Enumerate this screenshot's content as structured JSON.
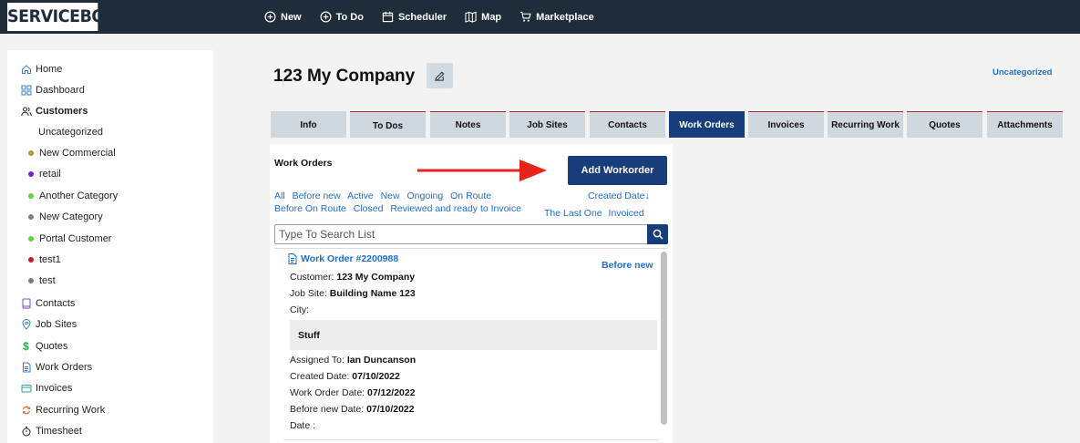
{
  "brand": {
    "logo_text": "SERVICEBOX"
  },
  "topnav": [
    {
      "label": "New",
      "icon": "plus-circle-icon"
    },
    {
      "label": "To Do",
      "icon": "plus-circle-icon"
    },
    {
      "label": "Scheduler",
      "icon": "calendar-icon"
    },
    {
      "label": "Map",
      "icon": "map-icon"
    },
    {
      "label": "Marketplace",
      "icon": "cart-icon"
    }
  ],
  "sidebar": {
    "items": [
      {
        "label": "Home",
        "icon": "home-icon"
      },
      {
        "label": "Dashboard",
        "icon": "dashboard-icon"
      },
      {
        "label": "Customers",
        "icon": "users-icon"
      }
    ],
    "customer_categories": [
      {
        "label": "Uncategorized",
        "color": ""
      },
      {
        "label": "New Commercial",
        "color": "#a69a3c"
      },
      {
        "label": "retail",
        "color": "#7a1fc8"
      },
      {
        "label": "Another Category",
        "color": "#5fd13e"
      },
      {
        "label": "New Category",
        "color": "#7f7f7f"
      },
      {
        "label": "Portal Customer",
        "color": "#5fd13e"
      },
      {
        "label": "test1",
        "color": "#c8192b"
      },
      {
        "label": "test",
        "color": "#7f7f7f"
      }
    ],
    "more_items": [
      {
        "label": "Contacts",
        "icon": "book-icon"
      },
      {
        "label": "Job Sites",
        "icon": "location-pin-icon"
      },
      {
        "label": "Quotes",
        "icon": "dollar-icon"
      },
      {
        "label": "Work Orders",
        "icon": "document-icon"
      },
      {
        "label": "Invoices",
        "icon": "card-icon"
      },
      {
        "label": "Recurring Work",
        "icon": "recurring-icon"
      },
      {
        "label": "Timesheet",
        "icon": "stopwatch-icon"
      }
    ]
  },
  "header": {
    "company_name": "123 My Company",
    "category_link": "Uncategorized"
  },
  "tabs": [
    {
      "label": "Info"
    },
    {
      "label": "To Dos"
    },
    {
      "label": "Notes"
    },
    {
      "label": "Job Sites"
    },
    {
      "label": "Contacts"
    },
    {
      "label": "Work Orders",
      "active": true
    },
    {
      "label": "Invoices"
    },
    {
      "label": "Recurring Work"
    },
    {
      "label": "Quotes"
    },
    {
      "label": "Attachments"
    }
  ],
  "panel": {
    "title": "Work Orders",
    "add_button": "Add Workorder",
    "filters_row1": [
      "All",
      "Before new",
      "Active",
      "New",
      "Ongoing",
      "On Route"
    ],
    "filters_row2": [
      "Before On Route",
      "Closed",
      "Reviewed and ready to Invoice"
    ],
    "sort_label": "Created Date",
    "sort_arrow": "↓",
    "right_links": [
      "The Last One",
      "Invoiced"
    ],
    "search_placeholder": "Type To Search List"
  },
  "work_order": {
    "title": "Work Order #2200988",
    "status": "Before new",
    "customer_label": "Customer:",
    "customer_value": "123 My Company",
    "job_site_label": "Job Site:",
    "job_site_value": "Building Name 123",
    "city_label": "City:",
    "description": "Stuff",
    "assigned_label": "Assigned To:",
    "assigned_value": "Ian Duncanson",
    "created_label": "Created Date:",
    "created_value": "07/10/2022",
    "wo_date_label": "Work Order Date:",
    "wo_date_value": "07/12/2022",
    "before_new_label": "Before new Date:",
    "before_new_value": "07/10/2022",
    "date_label": "Date :"
  },
  "colors": {
    "topbar": "#1e2d39",
    "accent": "#173d7a",
    "link": "#1d6fd1",
    "tab_border": "#b72331",
    "arrow": "#e8231b"
  }
}
